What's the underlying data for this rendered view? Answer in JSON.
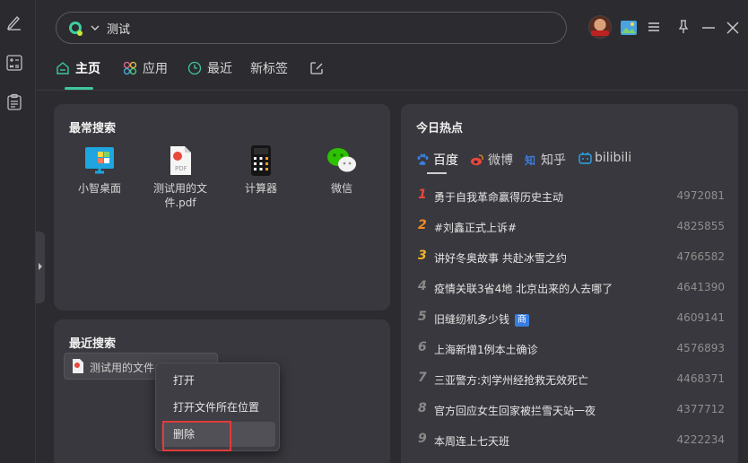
{
  "search": {
    "value": "测试"
  },
  "tabs": [
    {
      "label": "主页"
    },
    {
      "label": "应用"
    },
    {
      "label": "最近"
    },
    {
      "label": "新标签"
    }
  ],
  "frequent": {
    "title": "最常搜索",
    "items": [
      {
        "name": "小智桌面",
        "icon": "desktop-icon"
      },
      {
        "name": "测试用的文件.pdf",
        "icon": "pdf-file-icon"
      },
      {
        "name": "计算器",
        "icon": "calculator-icon"
      },
      {
        "name": "微信",
        "icon": "wechat-icon"
      }
    ]
  },
  "recent": {
    "title": "最近搜索",
    "chip": "测试用的文件...f"
  },
  "context_menu": {
    "items": [
      {
        "label": "打开"
      },
      {
        "label": "打开文件所在位置"
      },
      {
        "label": "删除"
      }
    ]
  },
  "hot": {
    "title": "今日热点",
    "sources": [
      {
        "label": "百度",
        "icon": "baidu-paw-icon"
      },
      {
        "label": "微博",
        "icon": "weibo-icon"
      },
      {
        "label": "知乎",
        "icon": "zhihu-icon"
      },
      {
        "label": "bilibili",
        "icon": "bilibili-icon"
      }
    ],
    "rank_colors": {
      "top1": "#e8473b",
      "top2": "#f08a24",
      "top3": "#f0b22a",
      "rest": "#8a8a8a"
    },
    "items": [
      {
        "rank": "1",
        "title": "勇于自我革命赢得历史主动",
        "count": "4972081"
      },
      {
        "rank": "2",
        "title": "#刘鑫正式上诉#",
        "count": "4825855"
      },
      {
        "rank": "3",
        "title": "讲好冬奥故事 共赴冰雪之约",
        "count": "4766582"
      },
      {
        "rank": "4",
        "title": "疫情关联3省4地 北京出来的人去哪了",
        "count": "4641390"
      },
      {
        "rank": "5",
        "title": "旧缝纫机多少钱",
        "count": "4609141",
        "badge": "商"
      },
      {
        "rank": "6",
        "title": "上海新增1例本土确诊",
        "count": "4576893"
      },
      {
        "rank": "7",
        "title": "三亚警方:刘学州经抢救无效死亡",
        "count": "4468371"
      },
      {
        "rank": "8",
        "title": "官方回应女生回家被拦雪天站一夜",
        "count": "4377712"
      },
      {
        "rank": "9",
        "title": "本周连上七天班",
        "count": "4222234"
      }
    ]
  }
}
